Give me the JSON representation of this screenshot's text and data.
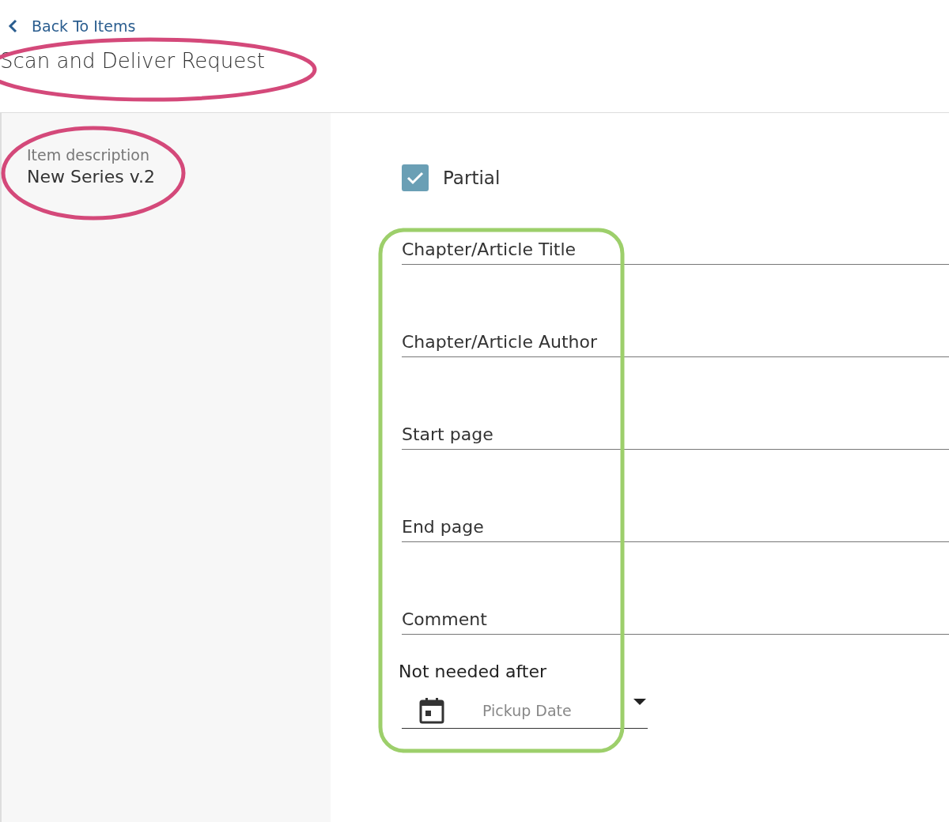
{
  "back_link": {
    "label": "Back To Items"
  },
  "page_title": "Scan and Deliver Request",
  "item": {
    "label": "Item description",
    "value": "New Series v.2"
  },
  "partial": {
    "label": "Partial",
    "checked": true
  },
  "fields": [
    {
      "label": "Chapter/Article Title"
    },
    {
      "label": "Chapter/Article Author"
    },
    {
      "label": "Start page"
    },
    {
      "label": "End page"
    },
    {
      "label": "Comment"
    }
  ],
  "date_field": {
    "label": "Not needed after",
    "placeholder": "Pickup Date"
  }
}
